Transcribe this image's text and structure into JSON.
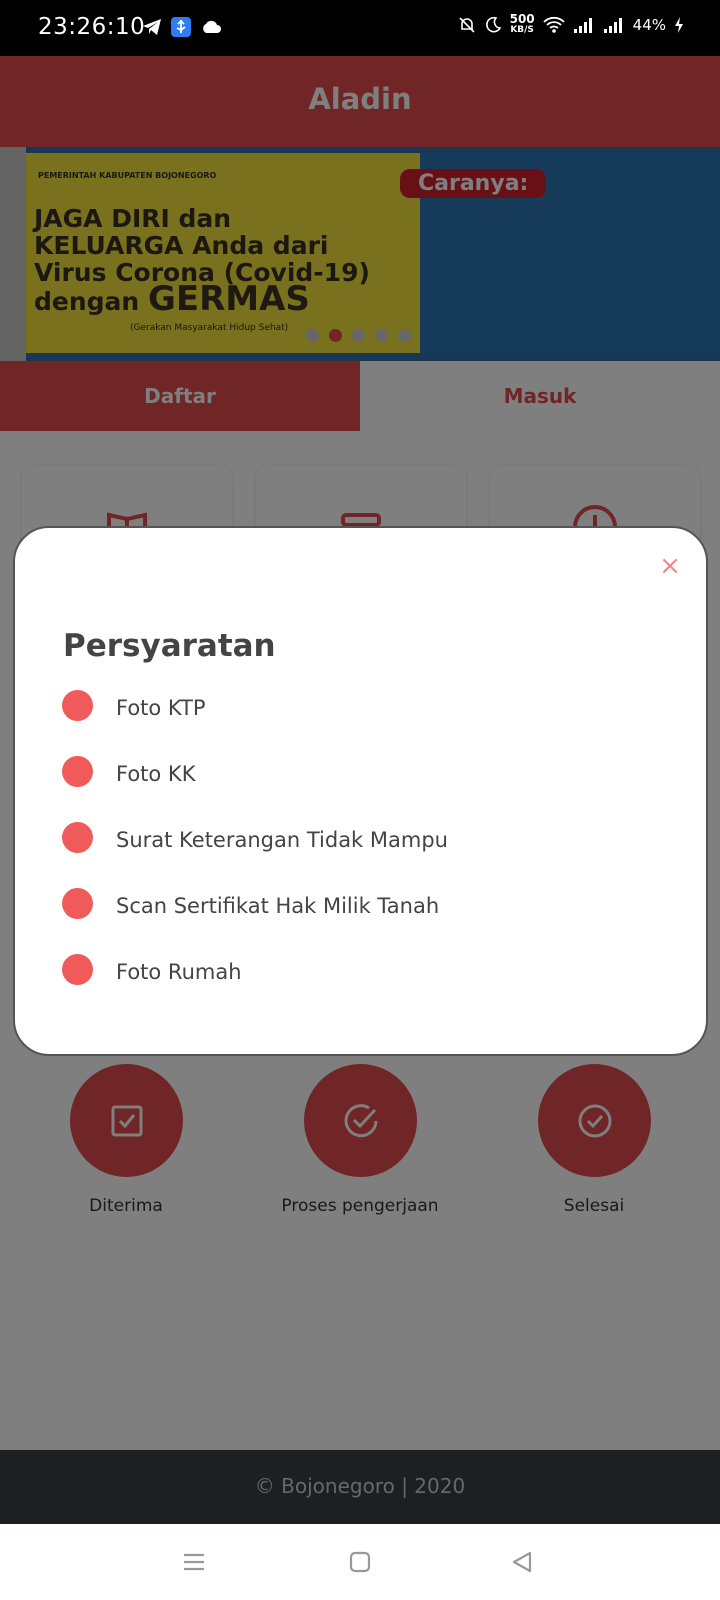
{
  "status_bar": {
    "time": "23:26:10",
    "net_speed_value": "500",
    "net_speed_unit": "KB/S",
    "battery": "44%"
  },
  "app": {
    "title": "Aladin"
  },
  "banner": {
    "org": "PEMERINTAH KABUPATEN BOJONEGORO",
    "headline_lines": [
      "JAGA DIRI dan",
      "KELUARGA Anda dari",
      "Virus Corona (Covid-19)",
      "dengan"
    ],
    "germas": "GERMAS",
    "germas_sub": "(Gerakan Masyarakat Hidup Sehat)",
    "caranya": "Caranya:",
    "slides_total": 5,
    "active_slide": 2
  },
  "tabs": {
    "register": "Daftar",
    "login": "Masuk"
  },
  "steps": [
    {
      "label": "Diterima"
    },
    {
      "label": "Proses pengerjaan"
    },
    {
      "label": "Selesai"
    }
  ],
  "footer": {
    "copyright": "© Bojonegoro | 2020"
  },
  "modal": {
    "title": "Persyaratan",
    "close_glyph": "×",
    "requirements": [
      "Foto KTP",
      "Foto KK",
      "Surat Keterangan Tidak Mampu",
      "Scan Sertifikat Hak Milik Tanah",
      "Foto Rumah"
    ]
  },
  "colors": {
    "brand": "#e14c4c",
    "bullet": "#f05a5a",
    "footer": "#3d3e44"
  }
}
